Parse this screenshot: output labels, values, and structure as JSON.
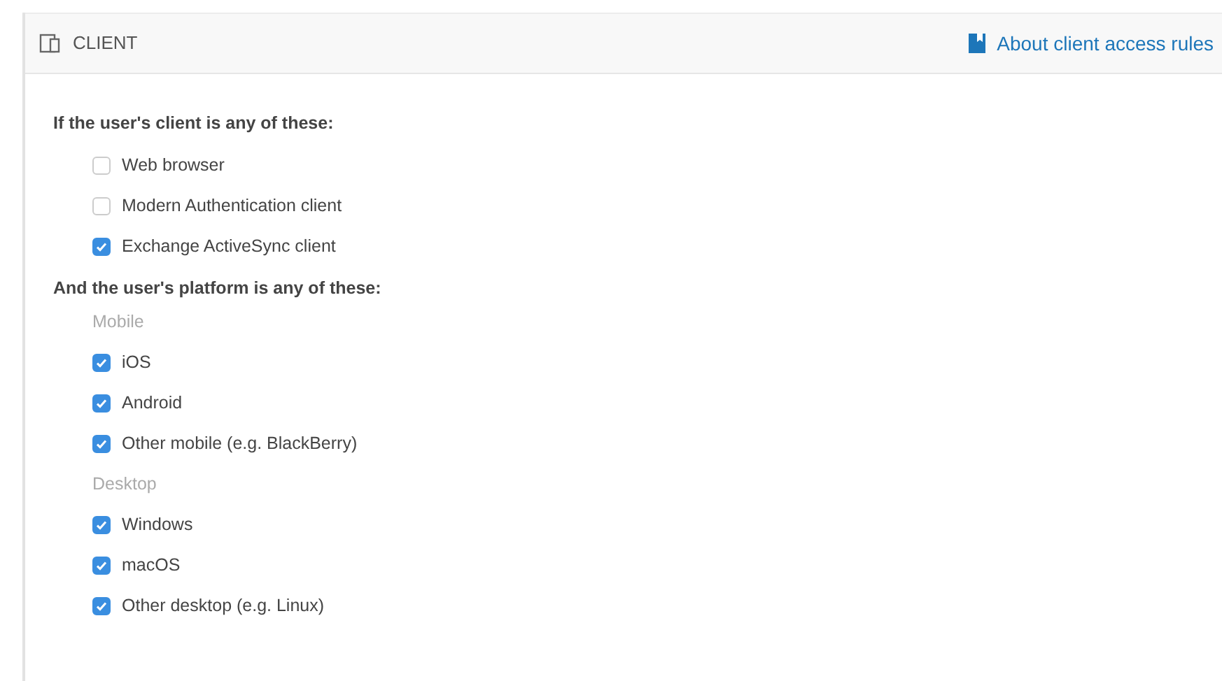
{
  "header": {
    "title": "CLIENT",
    "link": "About client access rules"
  },
  "sections": [
    {
      "heading": "If the user's client is any of these:",
      "groups": [
        {
          "options": [
            {
              "label": "Web browser",
              "checked": false
            },
            {
              "label": "Modern Authentication client",
              "checked": false
            },
            {
              "label": "Exchange ActiveSync client",
              "checked": true
            }
          ]
        }
      ]
    },
    {
      "heading": "And the user's platform is any of these:",
      "groups": [
        {
          "label": "Mobile",
          "options": [
            {
              "label": "iOS",
              "checked": true
            },
            {
              "label": "Android",
              "checked": true
            },
            {
              "label": "Other mobile (e.g. BlackBerry)",
              "checked": true
            }
          ]
        },
        {
          "label": "Desktop",
          "options": [
            {
              "label": "Windows",
              "checked": true
            },
            {
              "label": "macOS",
              "checked": true
            },
            {
              "label": "Other desktop (e.g. Linux)",
              "checked": true
            }
          ]
        }
      ]
    }
  ]
}
